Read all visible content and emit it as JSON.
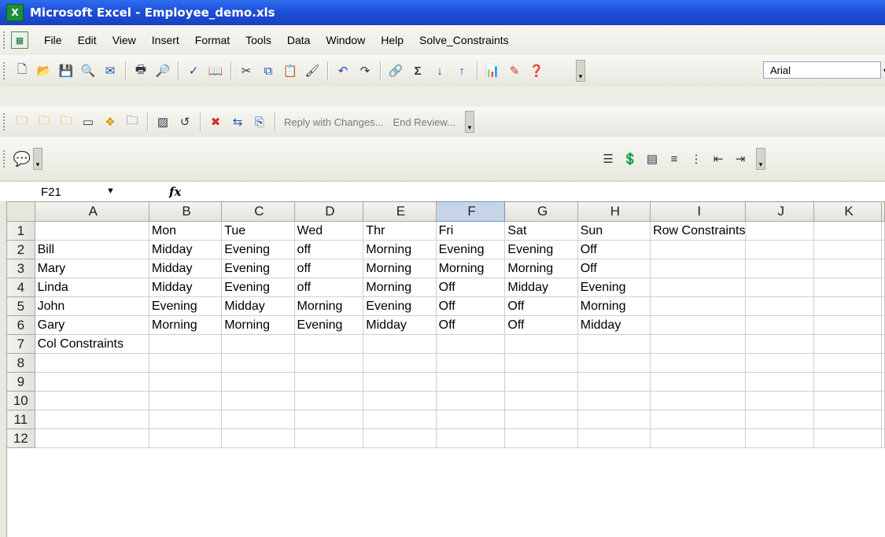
{
  "window": {
    "title": "Microsoft Excel - Employee_demo.xls"
  },
  "menu": {
    "items": [
      {
        "label": "File",
        "name": "menu-file"
      },
      {
        "label": "Edit",
        "name": "menu-edit"
      },
      {
        "label": "View",
        "name": "menu-view"
      },
      {
        "label": "Insert",
        "name": "menu-insert"
      },
      {
        "label": "Format",
        "name": "menu-format"
      },
      {
        "label": "Tools",
        "name": "menu-tools"
      },
      {
        "label": "Data",
        "name": "menu-data"
      },
      {
        "label": "Window",
        "name": "menu-window"
      },
      {
        "label": "Help",
        "name": "menu-help"
      },
      {
        "label": "Solve_Constraints",
        "name": "menu-solve-constraints"
      }
    ]
  },
  "toolbar": {
    "font_name": "Arial",
    "review": {
      "reply_label": "Reply with Changes...",
      "end_label": "End Review..."
    }
  },
  "formula_bar": {
    "name_box": "F21",
    "fx_label": "fx",
    "value": ""
  },
  "sheet": {
    "columns": [
      "A",
      "B",
      "C",
      "D",
      "E",
      "F",
      "G",
      "H",
      "I",
      "J",
      "K"
    ],
    "active_column": "F",
    "rows": [
      {
        "num": "1",
        "cells": [
          "",
          "Mon",
          "Tue",
          "Wed",
          "Thr",
          "Fri",
          "Sat",
          "Sun",
          "Row Constraints",
          "",
          ""
        ]
      },
      {
        "num": "2",
        "cells": [
          "Bill",
          "Midday",
          "Evening",
          "off",
          "Morning",
          "Evening",
          "Evening",
          "Off",
          "",
          "",
          ""
        ]
      },
      {
        "num": "3",
        "cells": [
          "Mary",
          "Midday",
          "Evening",
          "off",
          "Morning",
          "Morning",
          "Morning",
          "Off",
          "",
          "",
          ""
        ]
      },
      {
        "num": "4",
        "cells": [
          "Linda",
          "Midday",
          "Evening",
          "off",
          "Morning",
          "Off",
          "Midday",
          "Evening",
          "",
          "",
          ""
        ]
      },
      {
        "num": "5",
        "cells": [
          "John",
          "Evening",
          "Midday",
          "Morning",
          "Evening",
          "Off",
          "Off",
          "Morning",
          "",
          "",
          ""
        ]
      },
      {
        "num": "6",
        "cells": [
          "Gary",
          "Morning",
          "Morning",
          "Evening",
          "Midday",
          "Off",
          "Off",
          "Midday",
          "",
          "",
          ""
        ]
      },
      {
        "num": "7",
        "cells": [
          "Col Constraints",
          "",
          "",
          "",
          "",
          "",
          "",
          "",
          "",
          "",
          ""
        ]
      },
      {
        "num": "8",
        "cells": [
          "",
          "",
          "",
          "",
          "",
          "",
          "",
          "",
          "",
          "",
          ""
        ]
      },
      {
        "num": "9",
        "cells": [
          "",
          "",
          "",
          "",
          "",
          "",
          "",
          "",
          "",
          "",
          ""
        ]
      },
      {
        "num": "10",
        "cells": [
          "",
          "",
          "",
          "",
          "",
          "",
          "",
          "",
          "",
          "",
          ""
        ]
      },
      {
        "num": "11",
        "cells": [
          "",
          "",
          "",
          "",
          "",
          "",
          "",
          "",
          "",
          "",
          ""
        ]
      },
      {
        "num": "12",
        "cells": [
          "",
          "",
          "",
          "",
          "",
          "",
          "",
          "",
          "",
          "",
          ""
        ]
      }
    ]
  }
}
